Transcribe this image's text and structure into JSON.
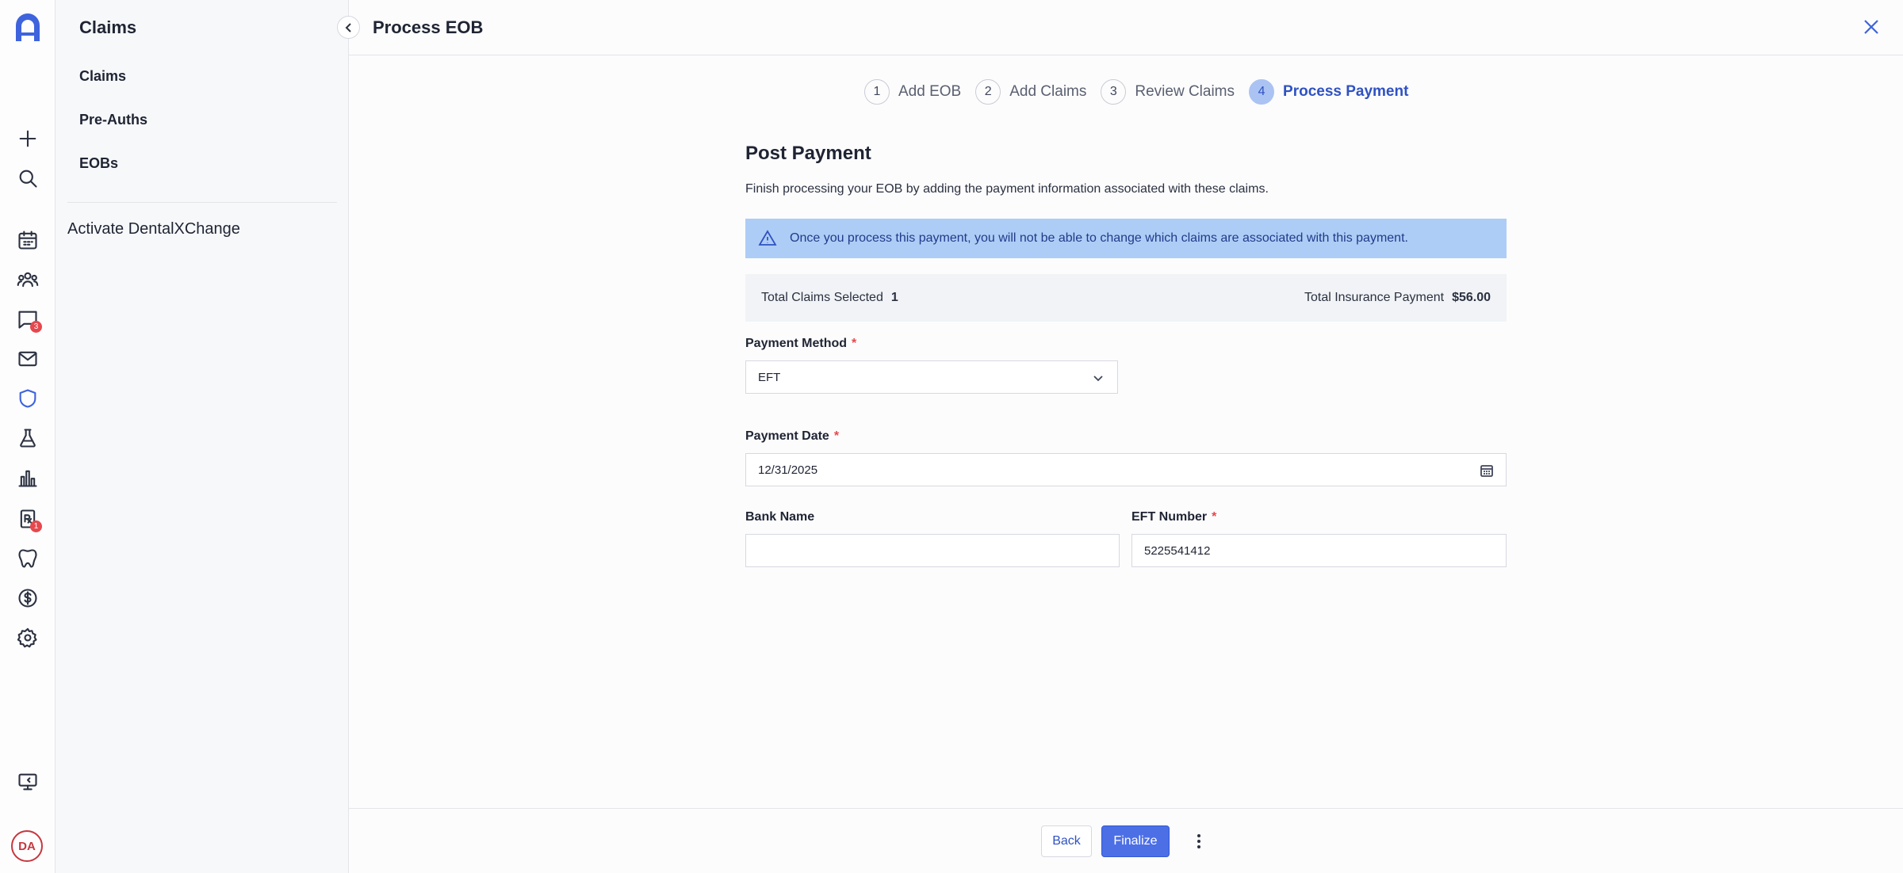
{
  "rail": {
    "icons": [
      "logo-icon",
      "plus-icon",
      "search-icon",
      "calendar-icon",
      "patients-icon",
      "messages-icon",
      "mail-icon",
      "shield-icon",
      "lab-flask-icon",
      "reports-chart-icon",
      "prescription-icon",
      "tooth-icon",
      "dollar-icon",
      "settings-icon",
      "monitor-icon"
    ],
    "messages_badge": "3",
    "prescription_badge": "1",
    "avatar": "DA",
    "active_color": "#3e63dd"
  },
  "sidebar": {
    "title": "Claims",
    "items": [
      {
        "label": "Claims"
      },
      {
        "label": "Pre-Auths"
      },
      {
        "label": "EOBs"
      }
    ],
    "activate_label": "Activate DentalXChange"
  },
  "header": {
    "title": "Process EOB"
  },
  "stepper": [
    {
      "num": "1",
      "label": "Add EOB"
    },
    {
      "num": "2",
      "label": "Add Claims"
    },
    {
      "num": "3",
      "label": "Review Claims"
    },
    {
      "num": "4",
      "label": "Process Payment",
      "active": true
    }
  ],
  "form": {
    "heading": "Post Payment",
    "description": "Finish processing your EOB by adding the payment information associated with these claims.",
    "alert": "Once you process this payment, you will not be able to change which claims are associated with this payment.",
    "summary": {
      "claims_label": "Total Claims Selected",
      "claims_value": "1",
      "payment_label": "Total Insurance Payment",
      "payment_value": "$56.00"
    },
    "payment_method": {
      "label": "Payment Method",
      "required": "*",
      "value": "EFT"
    },
    "payment_date": {
      "label": "Payment Date",
      "required": "*",
      "value": "12/31/2025"
    },
    "bank_name": {
      "label": "Bank Name",
      "value": ""
    },
    "eft_number": {
      "label": "EFT Number",
      "required": "*",
      "value": "5225541412"
    }
  },
  "footer": {
    "back_label": "Back",
    "finalize_label": "Finalize"
  }
}
